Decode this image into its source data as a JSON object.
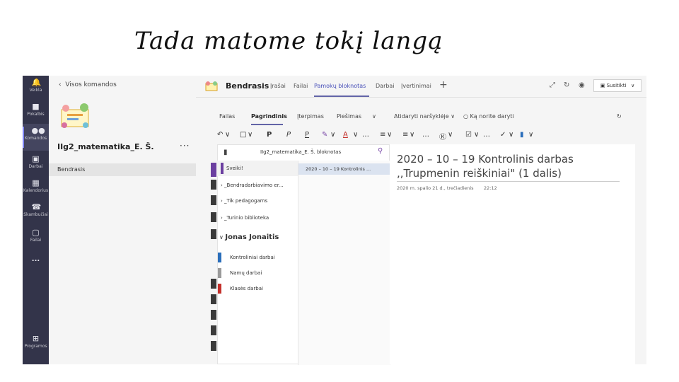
{
  "slide": {
    "title": "Tada matome tokį langą"
  },
  "rail": {
    "items": [
      {
        "label": "Veikla",
        "icon": "bell-icon"
      },
      {
        "label": "Pokalbis",
        "icon": "chat-icon"
      },
      {
        "label": "Komandos",
        "icon": "teams-icon"
      },
      {
        "label": "Darbai",
        "icon": "assignments-icon"
      },
      {
        "label": "Kalendorius",
        "icon": "calendar-icon"
      },
      {
        "label": "Skambučiai",
        "icon": "phone-icon"
      },
      {
        "label": "Failai",
        "icon": "files-icon"
      },
      {
        "label": "...",
        "icon": "more-icon"
      },
      {
        "label": "Programos",
        "icon": "apps-icon"
      }
    ]
  },
  "team_panel": {
    "back_label": "Visos komandos",
    "team_name": "IIg2_matematika_E. Š.",
    "more": "···",
    "channel": "Bendrasis"
  },
  "topbar": {
    "channel": "Bendrasis",
    "tabs": [
      "Įrašai",
      "Failai",
      "Pamokų bloknotas",
      "Darbai",
      "Įvertinimai"
    ],
    "active_tab": "Pamokų bloknotas",
    "plus": "+",
    "meet_label": "Susitikti",
    "meet_chevron": "∨"
  },
  "ribbon": {
    "tabs": [
      "Failas",
      "Pagrindinis",
      "Įterpimas",
      "Piešimas"
    ],
    "active_tab": "Pagrindinis",
    "chevron": "∨",
    "open_browser": "Atidaryti naršyklėje",
    "tell_me": "Ką norite daryti",
    "tool_chevron": "∨",
    "tools": {
      "bold": "P",
      "italic": "P",
      "underline": "P",
      "font_color": "A"
    }
  },
  "notebook": {
    "title": "IIg2_matematika_E. Š. bloknotas",
    "sections": [
      {
        "label": "Sveiki!",
        "color": "#6b3fa0"
      },
      {
        "label": "_Bendradarbiavimo er...",
        "color": "#3a3a3a"
      },
      {
        "label": "_Tik pedagogams",
        "color": "#3a3a3a"
      },
      {
        "label": "_Turinio biblioteka",
        "color": "#3a3a3a"
      }
    ],
    "student": "Jonas Jonaitis",
    "student_sections": [
      {
        "label": "Kontroliniai darbai",
        "color": "#2a6ebb"
      },
      {
        "label": "Namų darbai",
        "color": "#9a9a9a"
      },
      {
        "label": "Klasės darbai",
        "color": "#c4302b"
      }
    ],
    "pages": [
      "2020 – 10 – 19 Kontrolinis ..."
    ]
  },
  "page": {
    "title": "2020 – 10 – 19 Kontrolinis darbas ,,Trupmenin reiškiniai\" (1 dalis)",
    "date": "2020 m. spalio 21 d., trečiadienis",
    "time": "22:12"
  },
  "colors": {
    "rail": "#33344a",
    "accent": "#6264a7",
    "selected_page": "#dbe3f0"
  }
}
